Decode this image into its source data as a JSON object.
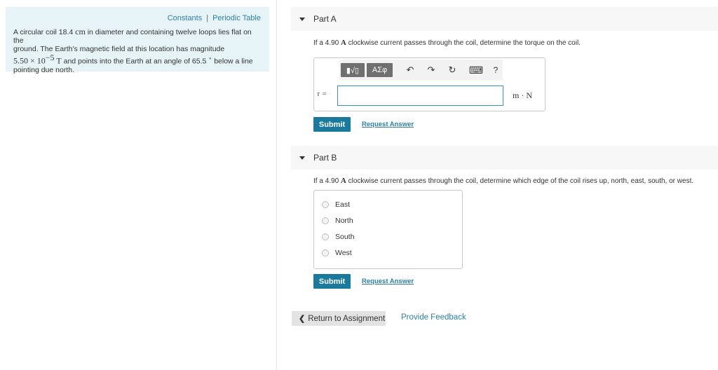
{
  "problem": {
    "links": {
      "constants": "Constants",
      "separator": "|",
      "periodic_table": "Periodic Table"
    },
    "text": {
      "line1_a": "A circular coil 18.4 ",
      "line1_unit": "cm",
      "line1_b": " in diameter and containing twelve loops lies flat on the",
      "line2": "ground. The Earth's magnetic field at this location has magnitude",
      "line3_value": "5.50 × 10",
      "line3_exp": "−5",
      "line3_unit": " T",
      "line3_b": " and points into the Earth at an angle of 65.5 ",
      "line3_deg": "∘",
      "line3_c": " below a line",
      "line4": "pointing due north."
    }
  },
  "part_a": {
    "title": "Part A",
    "question_a": "If a 4.90 ",
    "question_unit": "A",
    "question_b": " clockwise current passes through the coil, determine the torque on the coil.",
    "toolbar": {
      "template_btn": "▮√▯",
      "symbols_btn": "ΑΣφ",
      "undo": "↶",
      "redo": "↷",
      "reset": "↻",
      "keyboard": "⌨",
      "help": "?"
    },
    "variable_label": "τ =",
    "input_value": "",
    "unit": "m · N",
    "submit": "Submit",
    "request_answer": "Request Answer"
  },
  "part_b": {
    "title": "Part B",
    "question_a": "If a 4.90 ",
    "question_unit": "A",
    "question_b": " clockwise current passes through the coil, determine which edge of the coil rises up, north, east, south, or west.",
    "options": [
      "East",
      "North",
      "South",
      "West"
    ],
    "submit": "Submit",
    "request_answer": "Request Answer"
  },
  "footer": {
    "return": "Return to Assignment",
    "feedback": "Provide Feedback"
  }
}
